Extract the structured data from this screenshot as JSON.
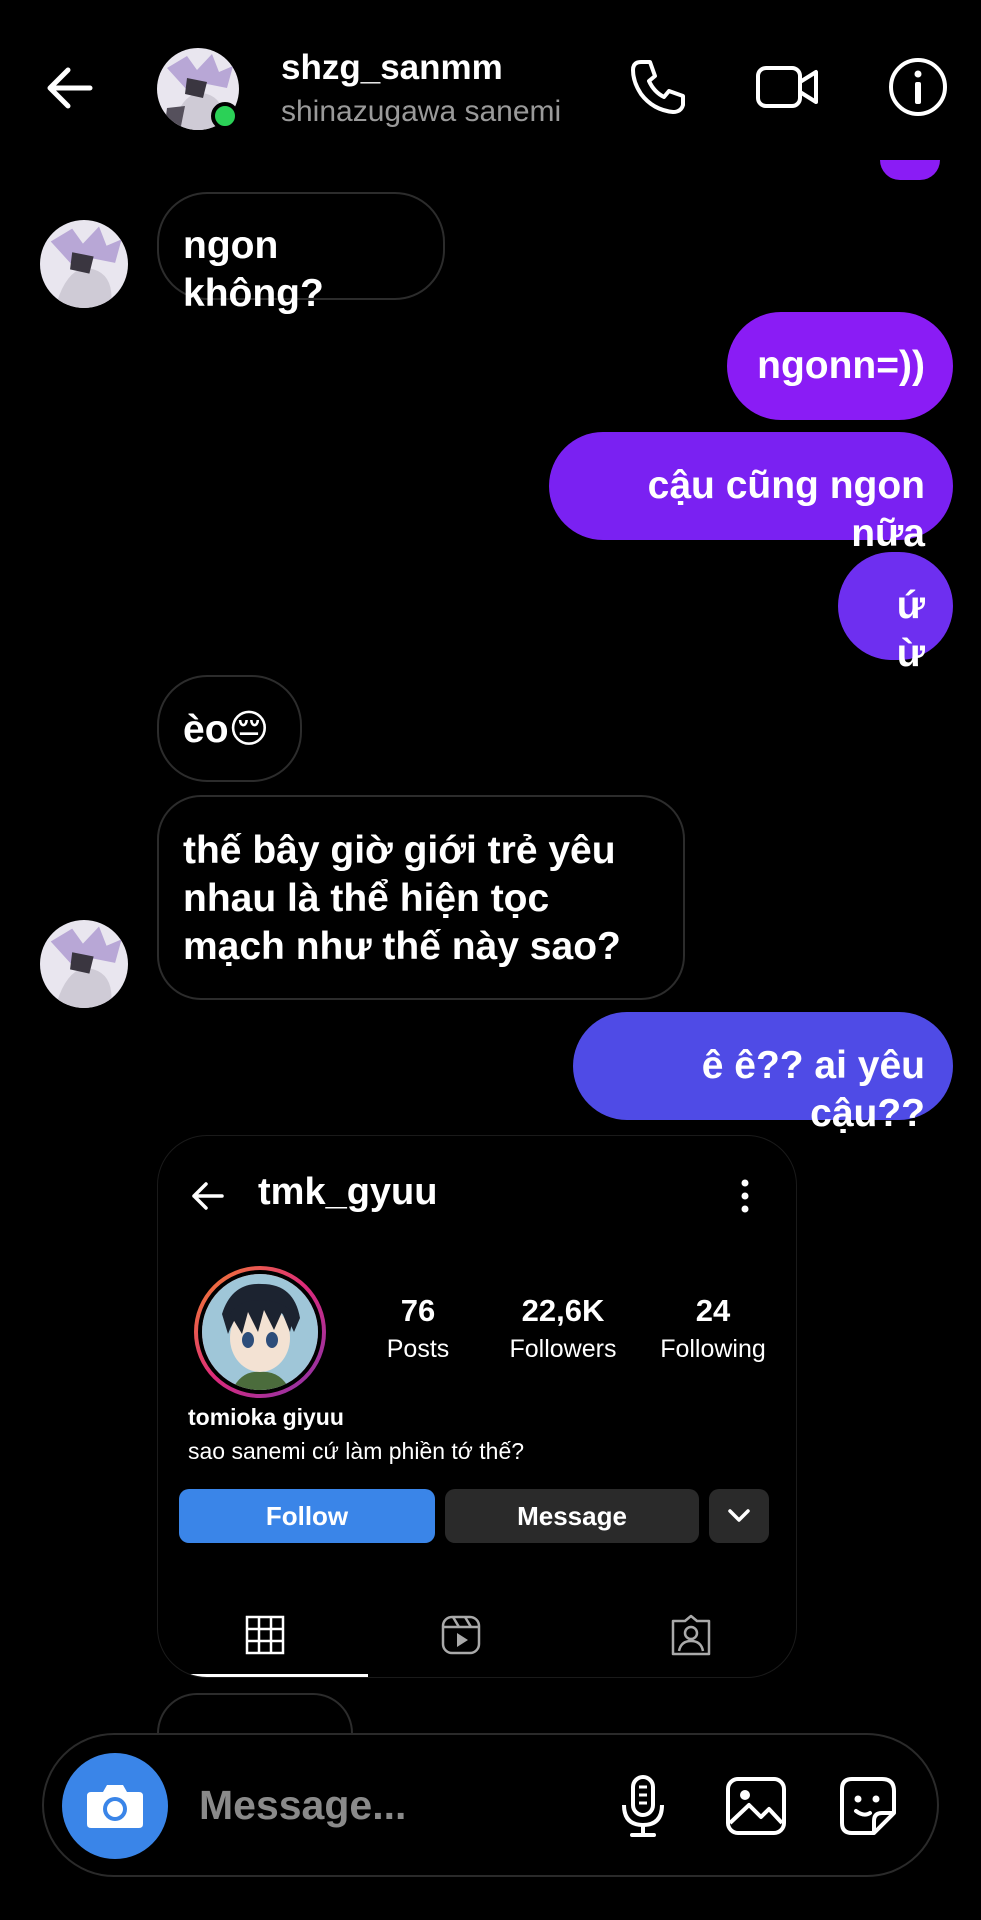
{
  "header": {
    "username": "shzg_sanmm",
    "display_name": "shinazugawa sanemi",
    "online_color": "#2bd157"
  },
  "messages": [
    {
      "side": "received",
      "text": "ngon không?"
    },
    {
      "side": "sent",
      "text": "ngonn=))"
    },
    {
      "side": "sent",
      "text": "cậu cũng ngon nữa"
    },
    {
      "side": "sent",
      "text": "ứ ừ"
    },
    {
      "side": "received",
      "text": "èo😔"
    },
    {
      "side": "received",
      "text": "thế bây giờ giới trẻ yêu nhau là thể hiện tọc mạch như thế này sao?"
    },
    {
      "side": "sent",
      "text": "ê ê?? ai yêu cậu??"
    }
  ],
  "shared_profile": {
    "username": "tmk_gyuu",
    "posts": "76",
    "posts_label": "Posts",
    "followers": "22,6K",
    "followers_label": "Followers",
    "following": "24",
    "following_label": "Following",
    "full_name": "tomioka giyuu",
    "bio": "sao sanemi cứ làm phiền tớ thế?",
    "follow_label": "Follow",
    "message_label": "Message"
  },
  "composer": {
    "placeholder": "Message..."
  },
  "colors": {
    "sent_top": "#8a1cf5",
    "sent_bottom": "#4f4be6",
    "accent_blue": "#3a85e8"
  },
  "icons": [
    "back-arrow-icon",
    "phone-icon",
    "video-camera-icon",
    "info-icon",
    "camera-icon",
    "microphone-icon",
    "gallery-icon",
    "sticker-icon",
    "grid-icon",
    "reels-icon",
    "tagged-icon",
    "more-vertical-icon",
    "chevron-down-icon"
  ]
}
